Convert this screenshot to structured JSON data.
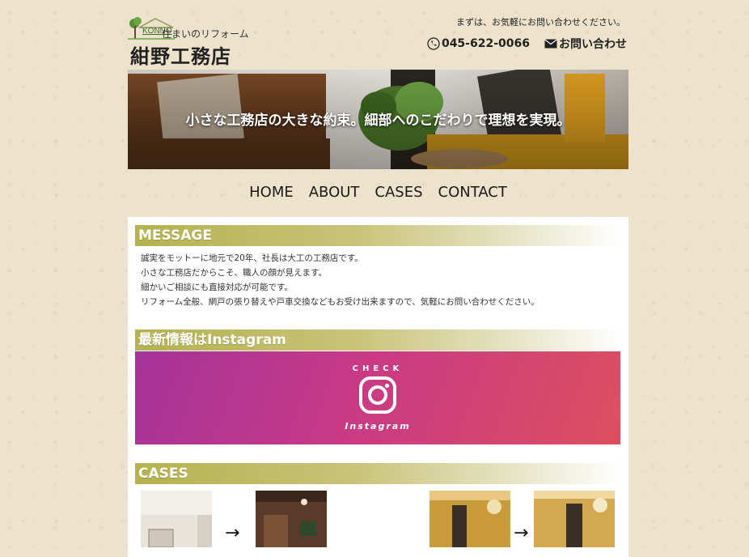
{
  "header": {
    "logo_konno": "KONNO",
    "logo_subtitle": "住まいのリフォーム",
    "logo_name": "紺野工務店",
    "contact_note": "まずは、お気軽にお問い合わせください。",
    "phone": "045-622-0066",
    "contact_link": "お問い合わせ"
  },
  "hero": {
    "copy": "小さな工務店の大きな約束。細部へのこだわりで理想を実現。"
  },
  "nav": {
    "items": [
      "HOME",
      "ABOUT",
      "CASES",
      "CONTACT"
    ]
  },
  "message": {
    "heading": "MESSAGE",
    "lines": [
      "誠実をモットーに地元で20年、社長は大工の工務店です。",
      "小さな工務店だからこそ、職人の顔が見えます。",
      "細かいご相談にも直接対応が可能です。",
      "リフォーム全般、網戸の張り替えや戸車交換などもお受け出来ますので、気軽にお問い合わせください。"
    ]
  },
  "instagram": {
    "heading": "最新情報はInstagram",
    "check": "CHECK",
    "label": "Instagram"
  },
  "cases": {
    "heading": "CASES",
    "arrow": "→"
  },
  "colors": {
    "background": "#ede3cc",
    "heading_gradient_start": "#b5b250",
    "instagram_start": "#a5339a",
    "instagram_end": "#dd4f5e"
  }
}
